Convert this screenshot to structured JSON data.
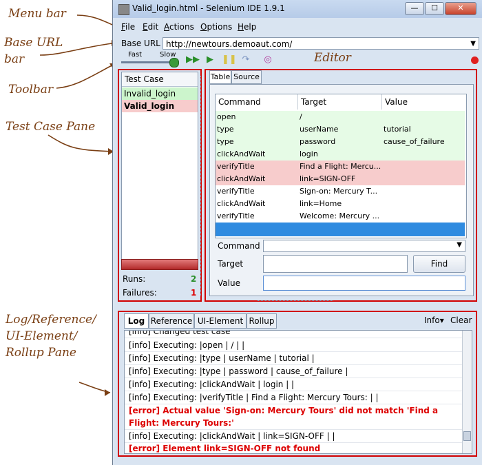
{
  "callouts": {
    "menu_bar": "Menu bar",
    "base_url_bar": "Base URL\nbar",
    "toolbar": "Toolbar",
    "test_case_pane": "Test Case Pane",
    "editor": "Editor",
    "log_pane": "Log/Reference/\nUI-Element/\nRollup Pane"
  },
  "window": {
    "title": "Valid_login.html - Selenium IDE 1.9.1",
    "minimize": "—",
    "maximize": "☐",
    "close": "✕"
  },
  "menu": [
    "File",
    "Edit",
    "Actions",
    "Options",
    "Help"
  ],
  "base_url": {
    "label": "Base URL",
    "value": "http://newtours.demoaut.com/"
  },
  "toolbar": {
    "fast": "Fast",
    "slow": "Slow"
  },
  "test_case_pane": {
    "header": "Test Case",
    "items": [
      "Invalid_login",
      "Valid_login"
    ],
    "runs_label": "Runs:",
    "runs_value": "2",
    "failures_label": "Failures:",
    "failures_value": "1"
  },
  "editor": {
    "tabs": [
      "Table",
      "Source"
    ],
    "columns": [
      "Command",
      "Target",
      "Value"
    ],
    "rows": [
      {
        "command": "open",
        "target": "/",
        "value": ""
      },
      {
        "command": "type",
        "target": "userName",
        "value": "tutorial"
      },
      {
        "command": "type",
        "target": "password",
        "value": "cause_of_failure"
      },
      {
        "command": "clickAndWait",
        "target": "login",
        "value": ""
      },
      {
        "command": "verifyTitle",
        "target": "Find a Flight: Mercu...",
        "value": ""
      },
      {
        "command": "clickAndWait",
        "target": "link=SIGN-OFF",
        "value": ""
      },
      {
        "command": "verifyTitle",
        "target": "Sign-on: Mercury T...",
        "value": ""
      },
      {
        "command": "clickAndWait",
        "target": "link=Home",
        "value": ""
      },
      {
        "command": "verifyTitle",
        "target": "Welcome: Mercury ...",
        "value": ""
      }
    ],
    "command_label": "Command",
    "target_label": "Target",
    "value_label": "Value",
    "find_button": "Find"
  },
  "log": {
    "tabs": [
      "Log",
      "Reference",
      "UI-Element",
      "Rollup"
    ],
    "info_menu": "Info▾",
    "clear": "Clear",
    "lines": [
      "[info] Changed test case",
      "[info] Executing: |open | / | |",
      "[info] Executing: |type | userName | tutorial |",
      "[info] Executing: |type | password | cause_of_failure |",
      "[info] Executing: |clickAndWait | login | |",
      "[info] Executing: |verifyTitle | Find a Flight: Mercury Tours: | |",
      "[error] Actual value 'Sign-on: Mercury Tours' did not match 'Find a Flight: Mercury Tours:'",
      "[info] Executing: |clickAndWait | link=SIGN-OFF | |",
      "[error] Element link=SIGN-OFF not found"
    ]
  }
}
